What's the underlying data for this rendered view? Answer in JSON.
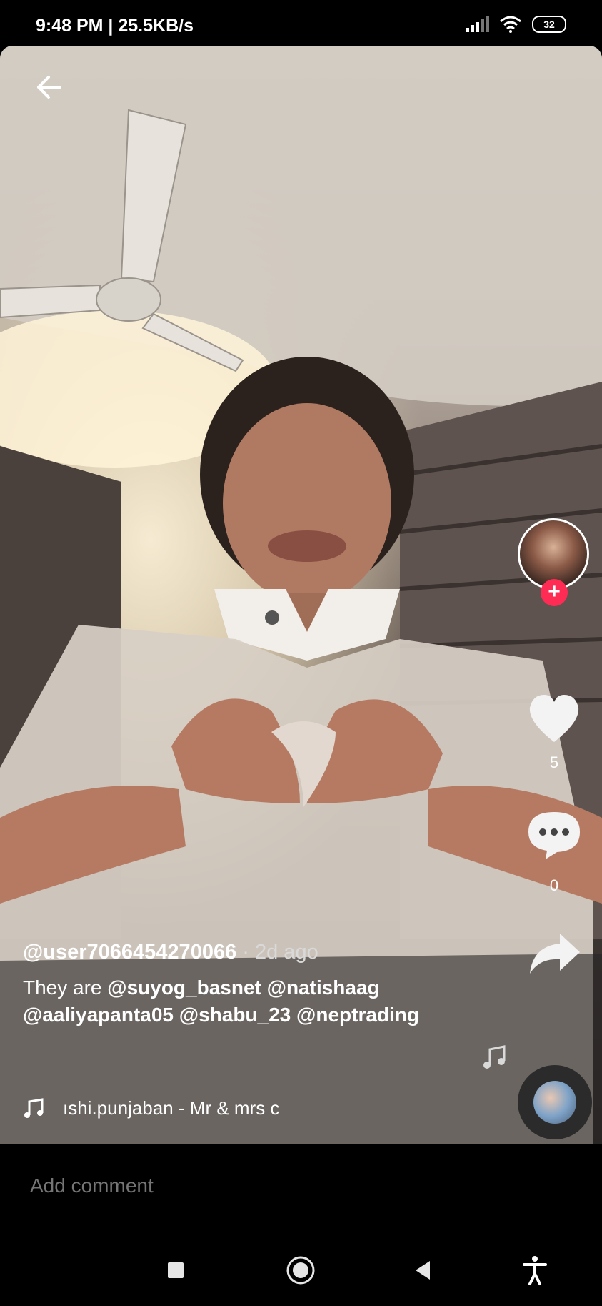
{
  "status_bar": {
    "time_speed": "9:48 PM | 25.5KB/s",
    "battery": "32"
  },
  "video": {
    "creator_username": "@user7066454270066",
    "posted_ago": "· 2d ago",
    "caption_prefix": "They are",
    "mentions": [
      "@suyog_basnet",
      "@natishaag",
      "@aaliyapanta05",
      "@shabu_23",
      "@neptrading"
    ],
    "music_text": "ıshi.punjaban - Mr & mrs c"
  },
  "actions": {
    "like_count": "5",
    "comment_count": "0",
    "follow_symbol": "+"
  },
  "comment_bar": {
    "placeholder": "Add comment"
  },
  "icons": {
    "back": "arrow-left-icon",
    "like": "heart-icon",
    "comment": "speech-bubble-icon",
    "share": "share-arrow-icon",
    "music": "music-note-icon",
    "accent": "#fe2c55"
  }
}
